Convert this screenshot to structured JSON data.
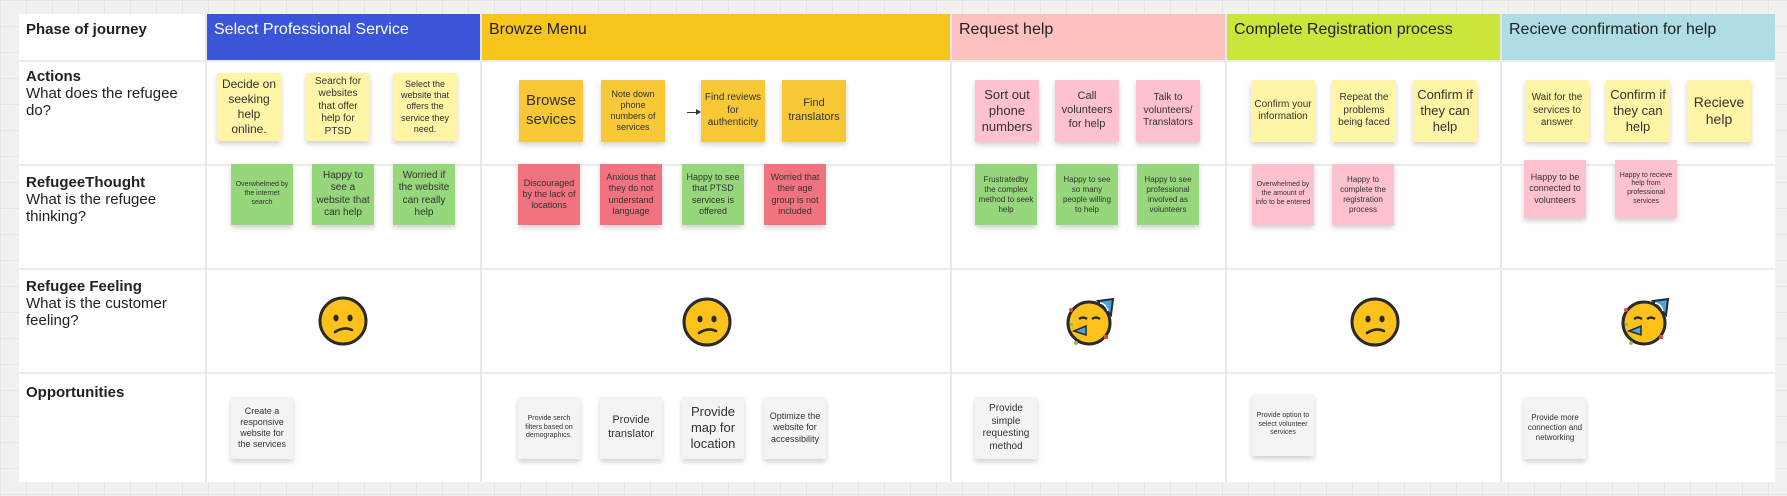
{
  "board": {
    "row_labels": [
      {
        "title": "Phase of journey",
        "sub": ""
      },
      {
        "title": "Actions",
        "sub": "What does the refugee do?"
      },
      {
        "title": "RefugeeThought",
        "sub": "What is the refugee thinking?"
      },
      {
        "title": "Refugee Feeling",
        "sub": "What is the customer feeling?"
      },
      {
        "title": "Opportunities",
        "sub": ""
      }
    ],
    "phases": [
      {
        "label": "Select Professional Service",
        "color": "#3b55d9",
        "text_color": "#ffffff"
      },
      {
        "label": "Browze Menu",
        "color": "#f8c51c",
        "text_color": "#222222"
      },
      {
        "label": "Request help",
        "color": "#ffc0c0",
        "text_color": "#222222"
      },
      {
        "label": "Complete Registration process",
        "color": "#cce53b",
        "text_color": "#222222"
      },
      {
        "label": "Recieve confirmation for help",
        "color": "#aedde6",
        "text_color": "#222222"
      }
    ],
    "actions": [
      "Decide on seeking help online.",
      "Search for websites that offer help for PTSD",
      "Select the website that offers the service they need.",
      "Browse sevices",
      "Note down phone numbers of services",
      "Find reviews for authenticity",
      "Find translators",
      "Sort out phone numbers",
      "Call volunteers for help",
      "Talk to volunteers/ Translators",
      "Confirm your information",
      "Repeat the problems being faced",
      "Confirm if they can help",
      "Wait for the services to answer",
      "Confirm if they can help",
      "Recieve help"
    ],
    "thoughts": [
      "Overwhelmed by the internet search",
      "Happy to see a website that can help",
      "Worried if the website can really help",
      "Discouraged by the lack of locations",
      "Anxious that they do not understand language",
      "Happy to see that PTSD services is offered",
      "Worried that their age group is not included",
      "Frustratedby the complex method to seek help",
      "Happy to see so many people willing to help",
      "Happy to see professional involved as volunteers",
      "Overwhelmed by the amount of info to be entered",
      "Happy to complete the registration process",
      "Happy to be connected to volunteers",
      "Happy to recieve help from professional services"
    ],
    "feelings": [
      {
        "icon": "confused-face-icon"
      },
      {
        "icon": "confused-face-icon"
      },
      {
        "icon": "party-face-icon"
      },
      {
        "icon": "confused-face-icon"
      },
      {
        "icon": "party-face-icon"
      }
    ],
    "opportunities": [
      "Create a responsive website for the services",
      "Provide serch filters based on demographics.",
      "Provide translator",
      "Provide map for location",
      "Optimize the website for accessibility",
      "Provide simple requesting method",
      "Provide option to select volunteer services",
      "Provide more connection and networking"
    ]
  }
}
